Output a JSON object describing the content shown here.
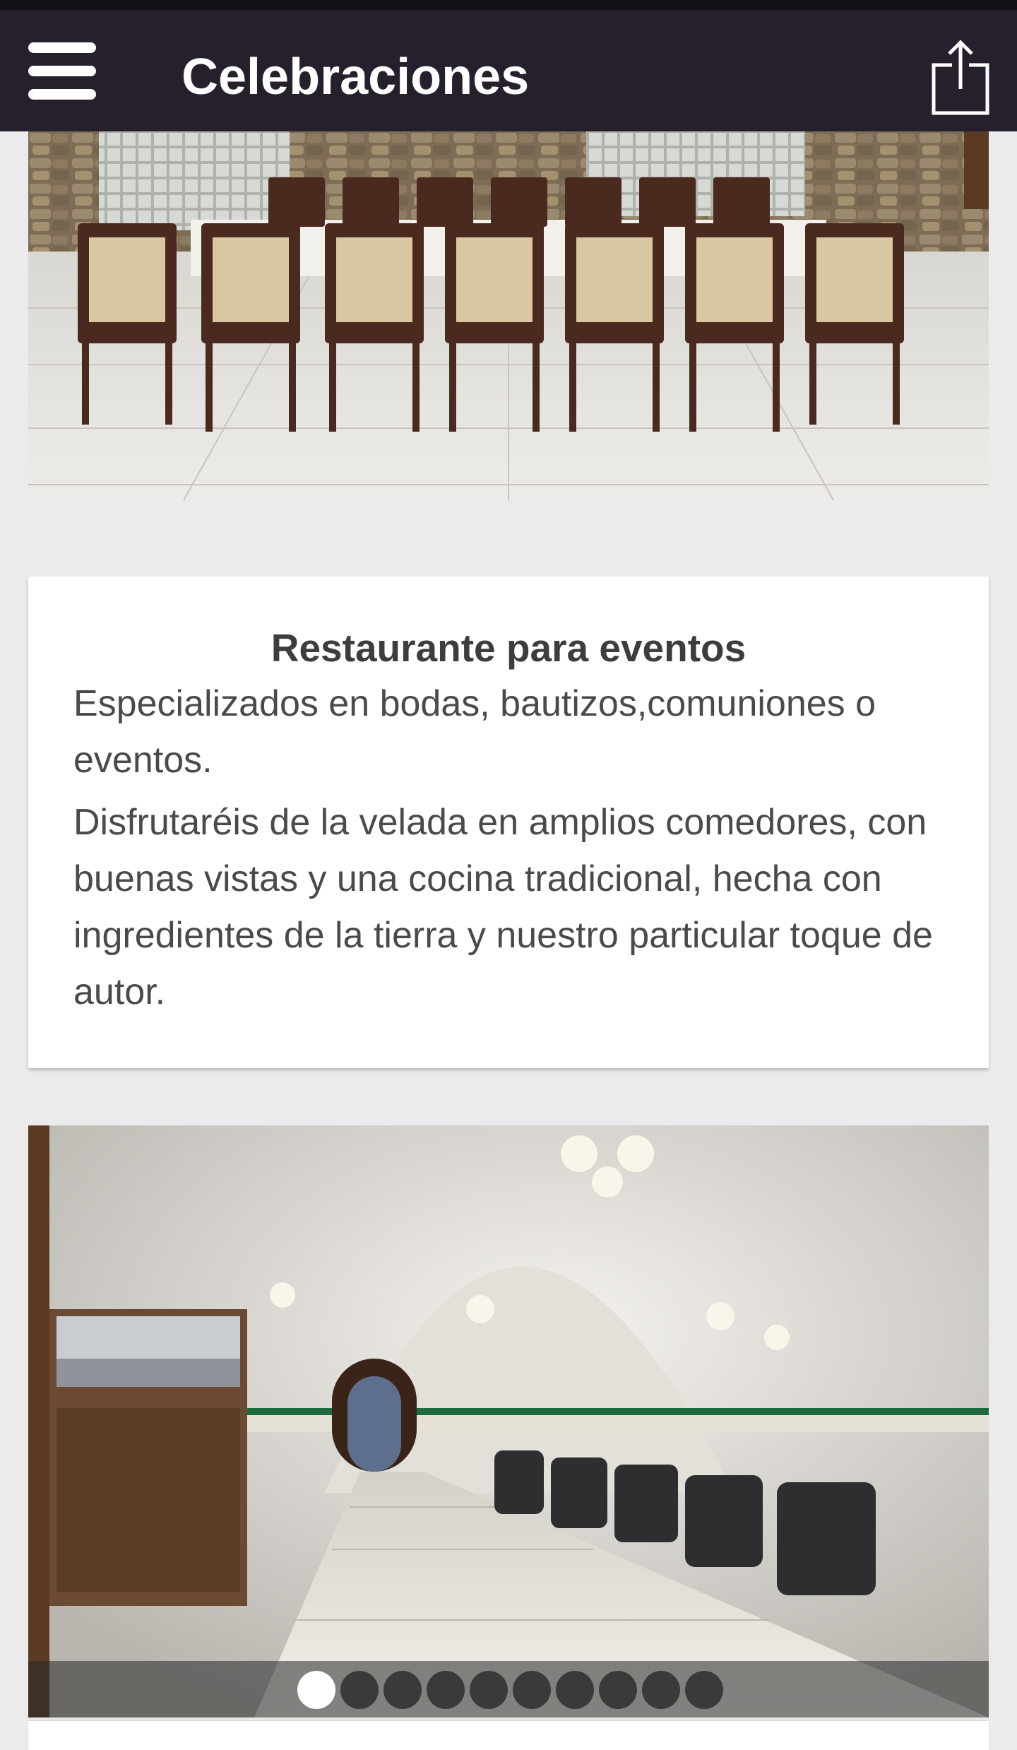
{
  "app_bar": {
    "title": "Celebraciones",
    "menu_icon": "hamburger-menu-icon",
    "share_icon": "share-icon"
  },
  "card": {
    "title": "Restaurante para eventos",
    "paragraph_1": "Especializados en bodas, bautizos,comuniones o eventos.",
    "paragraph_2": "Disfrutaréis de la velada en amplios comedores, con buenas vistas y una cocina tradicional, hecha con ingredientes de la tierra y nuestro particular toque de autor."
  },
  "gallery": {
    "total_slides": 10,
    "active_slide": 1
  },
  "colors": {
    "app_bar": "#26202d",
    "page_background": "#ebebeb",
    "card_text": "#4a4a4a"
  }
}
